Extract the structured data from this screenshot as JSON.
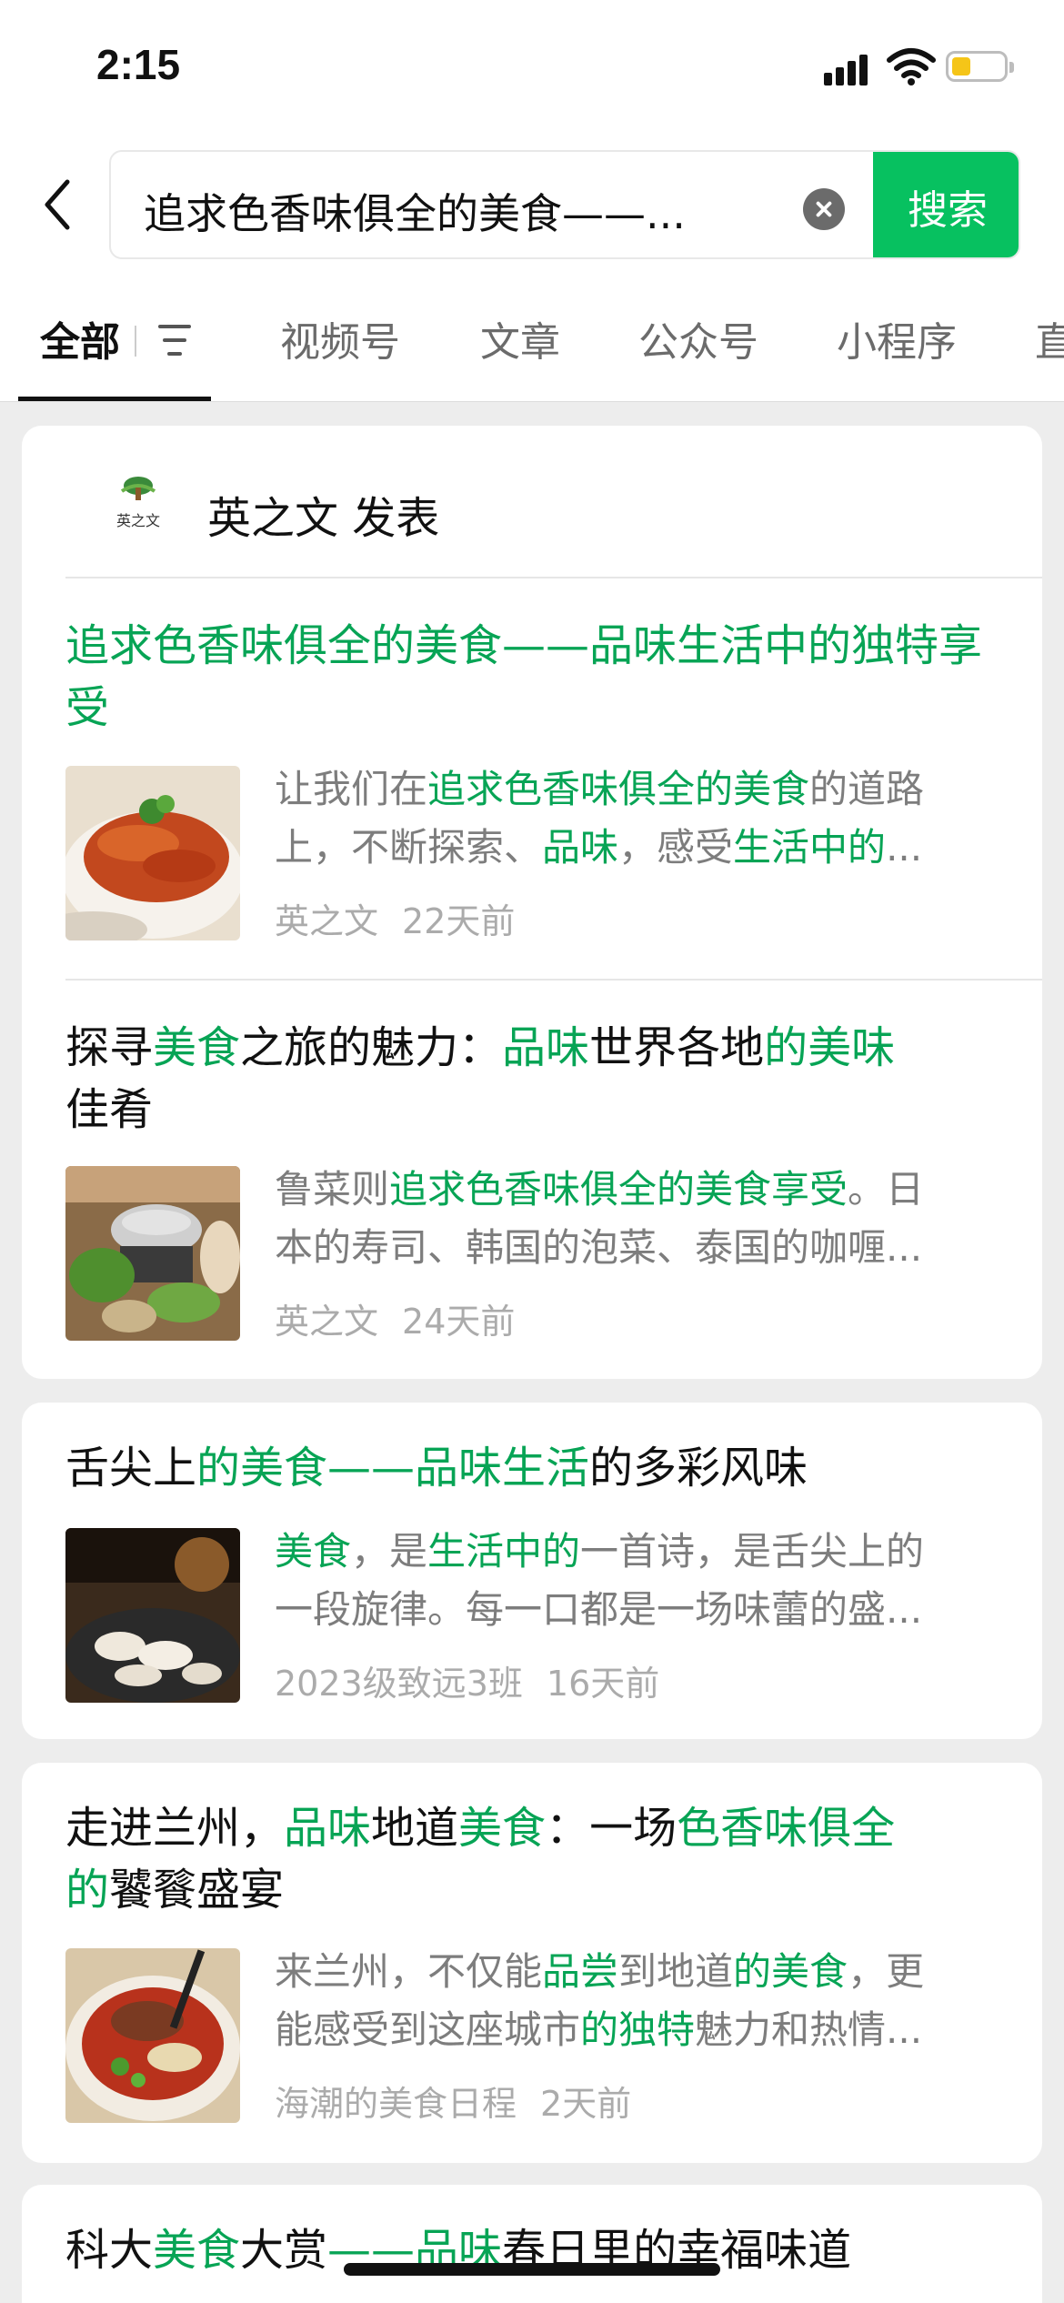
{
  "status": {
    "time": "2:15"
  },
  "search": {
    "query": "追求色香味俱全的美食——...",
    "button_label": "搜索"
  },
  "tabs": [
    {
      "label": "全部"
    },
    {
      "label": "视频号"
    },
    {
      "label": "文章"
    },
    {
      "label": "公众号"
    },
    {
      "label": "小程序"
    },
    {
      "label": "直"
    }
  ],
  "account": {
    "name": "英之文 发表",
    "logo_text": "英之文"
  },
  "articles": [
    {
      "title": [
        "追求色香味俱全的美食——品味生活中的独特享受"
      ],
      "excerpt_line1": [
        "让我们在",
        "追求色香味俱全的美食",
        "的道路"
      ],
      "excerpt_line2": [
        "上，不断探索、",
        "品味",
        "，感受",
        "生活中的",
        "..."
      ],
      "source": "英之文",
      "time": "22天前"
    },
    {
      "title": [
        "探寻",
        "美食",
        "之旅的魅力：",
        "品味",
        "世界各地",
        "的美味",
        "佳肴"
      ],
      "excerpt_line1": [
        "鲁菜则",
        "追求色香味俱全的美食享受",
        "。日"
      ],
      "excerpt_line2": [
        "本的寿司、韩国的泡菜、泰国的咖喱..."
      ],
      "source": "英之文",
      "time": "24天前"
    },
    {
      "title": [
        "舌尖上",
        "的美食——品味生活",
        "的多彩风味"
      ],
      "excerpt_line1": [
        "美食",
        "，是",
        "生活中的",
        "一首诗，是舌尖上的"
      ],
      "excerpt_line2": [
        "一段旋律。每一口都是一场味蕾的盛..."
      ],
      "source": "2023级致远3班",
      "time": "16天前"
    },
    {
      "title": [
        "走进兰州，",
        "品味",
        "地道",
        "美食",
        "：一场",
        "色香味俱全",
        "的",
        "饕餮盛宴"
      ],
      "excerpt_line1": [
        "来兰州，不仅能",
        "品尝",
        "到地道",
        "的美食",
        "，更"
      ],
      "excerpt_line2": [
        "能感受到这座城市",
        "的独特",
        "魅力和热情..."
      ],
      "source": "海潮的美食日程",
      "time": "2天前"
    },
    {
      "title": [
        "科大",
        "美食",
        "大赏",
        "——品味",
        "春日里的幸福味道"
      ]
    }
  ],
  "colors": {
    "accent": "#07c160",
    "highlight": "#07a455"
  }
}
